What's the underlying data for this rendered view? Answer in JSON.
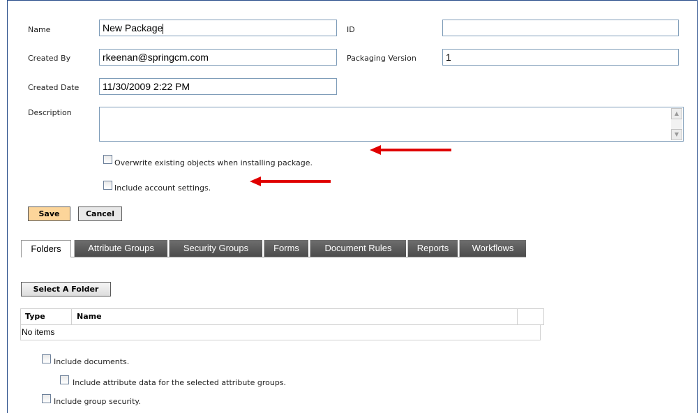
{
  "form": {
    "name_label": "Name",
    "name_value": "New Package",
    "id_label": "ID",
    "id_value": "",
    "created_by_label": "Created By",
    "created_by_value": "rkeenan@springcm.com",
    "packaging_version_label": "Packaging Version",
    "packaging_version_value": "1",
    "created_date_label": "Created Date",
    "created_date_value": "11/30/2009 2:22 PM",
    "description_label": "Description",
    "description_value": ""
  },
  "options": {
    "overwrite_label": "Overwrite existing objects when installing package.",
    "overwrite_checked": false,
    "include_account_label": "Include account settings.",
    "include_account_checked": false
  },
  "actions": {
    "save_label": "Save",
    "cancel_label": "Cancel"
  },
  "tabs": [
    {
      "label": "Folders",
      "active": true
    },
    {
      "label": "Attribute Groups",
      "active": false
    },
    {
      "label": "Security Groups",
      "active": false
    },
    {
      "label": "Forms",
      "active": false
    },
    {
      "label": "Document Rules",
      "active": false
    },
    {
      "label": "Reports",
      "active": false
    },
    {
      "label": "Workflows",
      "active": false
    }
  ],
  "folders": {
    "select_label": "Select A Folder",
    "columns": [
      "Type",
      "Name"
    ],
    "empty_text": "No items",
    "include_documents_label": "Include documents.",
    "include_attribute_data_label": "Include attribute data for the selected attribute groups.",
    "include_group_security_label": "Include group security."
  },
  "colors": {
    "annotation_arrow": "#e00000",
    "save_button": "#fcd59a",
    "frame_border": "#2b4f8c"
  }
}
